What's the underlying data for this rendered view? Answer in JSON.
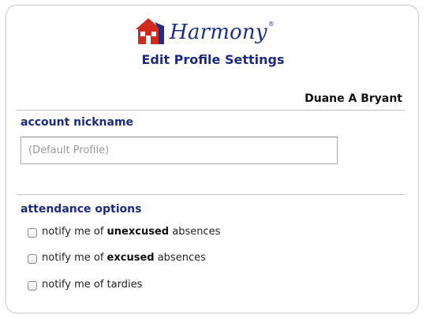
{
  "header": {
    "logo_text": "Harmony",
    "logo_mark": "®",
    "logo_icon": "schoolhouse-icon",
    "title": "Edit Profile Settings"
  },
  "user": {
    "name": "Duane A Bryant"
  },
  "account": {
    "heading": "account nickname",
    "nickname_value": "",
    "nickname_placeholder": "(Default Profile)"
  },
  "attendance": {
    "heading": "attendance options",
    "options": [
      {
        "prefix": "notify me of ",
        "bold": "unexcused",
        "suffix": " absences",
        "checked": false
      },
      {
        "prefix": "notify me of ",
        "bold": "excused",
        "suffix": " absences",
        "checked": false
      },
      {
        "prefix": "notify me of tardies",
        "bold": "",
        "suffix": "",
        "checked": false
      }
    ]
  },
  "colors": {
    "heading": "#1d2a7f",
    "logo_blue": "#1d2f8a",
    "logo_red": "#d12a1f"
  }
}
